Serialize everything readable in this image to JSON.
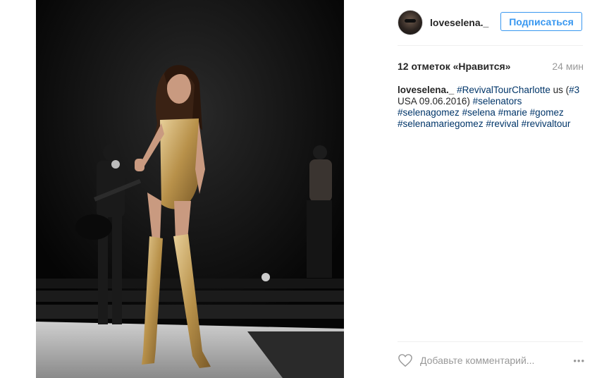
{
  "post": {
    "image_alt": "",
    "username": "loveselena._",
    "follow_label": "Подписаться",
    "likes_text": "12 отметок «Нравится»",
    "time_text": "24 мин",
    "caption": {
      "user": "loveselena._",
      "parts": [
        {
          "text": "#RevivalTourCharlotte",
          "tag": true
        },
        {
          "text": " us (",
          "tag": false
        },
        {
          "text": "#3",
          "tag": true
        },
        {
          "text": " USA 09.06.2016) ",
          "tag": false
        },
        {
          "text": "#selenators",
          "tag": true
        },
        {
          "text": " ",
          "tag": false
        },
        {
          "text": "#selenagomez",
          "tag": true
        },
        {
          "text": " ",
          "tag": false
        },
        {
          "text": "#selena",
          "tag": true
        },
        {
          "text": " ",
          "tag": false
        },
        {
          "text": "#marie",
          "tag": true
        },
        {
          "text": " ",
          "tag": false
        },
        {
          "text": "#gomez",
          "tag": true
        },
        {
          "text": " ",
          "tag": false
        },
        {
          "text": "#selenamariegomez",
          "tag": true
        },
        {
          "text": " ",
          "tag": false
        },
        {
          "text": "#revival",
          "tag": true
        },
        {
          "text": " ",
          "tag": false
        },
        {
          "text": "#revivaltour",
          "tag": true
        }
      ]
    },
    "comment_placeholder": "Добавьте комментарий...",
    "more_label": "•••"
  },
  "colors": {
    "accent": "#3897f0",
    "hashtag": "#003569",
    "muted": "#999999",
    "text": "#262626"
  }
}
